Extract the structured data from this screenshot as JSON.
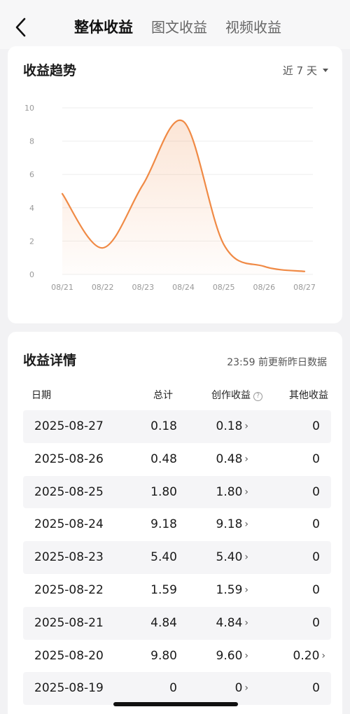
{
  "header": {
    "tabs": [
      {
        "label": "整体收益",
        "active": true
      },
      {
        "label": "图文收益",
        "active": false
      },
      {
        "label": "视频收益",
        "active": false
      }
    ]
  },
  "trend": {
    "title": "收益趋势",
    "range_label": "近 7 天"
  },
  "chart_data": {
    "type": "area",
    "x": [
      "08/21",
      "08/22",
      "08/23",
      "08/24",
      "08/25",
      "08/26",
      "08/27"
    ],
    "values": [
      4.84,
      1.59,
      5.4,
      9.18,
      1.8,
      0.48,
      0.18
    ],
    "yticks": [
      0,
      2,
      4,
      6,
      8,
      10
    ],
    "ylim": [
      0,
      10
    ],
    "line_color": "#f08a45",
    "grid": true
  },
  "detail": {
    "title": "收益详情",
    "update_note": "23:59 前更新昨日数据",
    "columns": {
      "date": "日期",
      "total": "总计",
      "creation": "创作收益",
      "other": "其他收益"
    },
    "rows": [
      {
        "date": "2025-08-27",
        "total": "0.18",
        "creation": "0.18",
        "other": "0"
      },
      {
        "date": "2025-08-26",
        "total": "0.48",
        "creation": "0.48",
        "other": "0"
      },
      {
        "date": "2025-08-25",
        "total": "1.80",
        "creation": "1.80",
        "other": "0"
      },
      {
        "date": "2025-08-24",
        "total": "9.18",
        "creation": "9.18",
        "other": "0"
      },
      {
        "date": "2025-08-23",
        "total": "5.40",
        "creation": "5.40",
        "other": "0"
      },
      {
        "date": "2025-08-22",
        "total": "1.59",
        "creation": "1.59",
        "other": "0"
      },
      {
        "date": "2025-08-21",
        "total": "4.84",
        "creation": "4.84",
        "other": "0"
      },
      {
        "date": "2025-08-20",
        "total": "9.80",
        "creation": "9.60",
        "other": "0.20",
        "other_link": true
      },
      {
        "date": "2025-08-19",
        "total": "0",
        "creation": "0",
        "other": "0"
      }
    ]
  }
}
